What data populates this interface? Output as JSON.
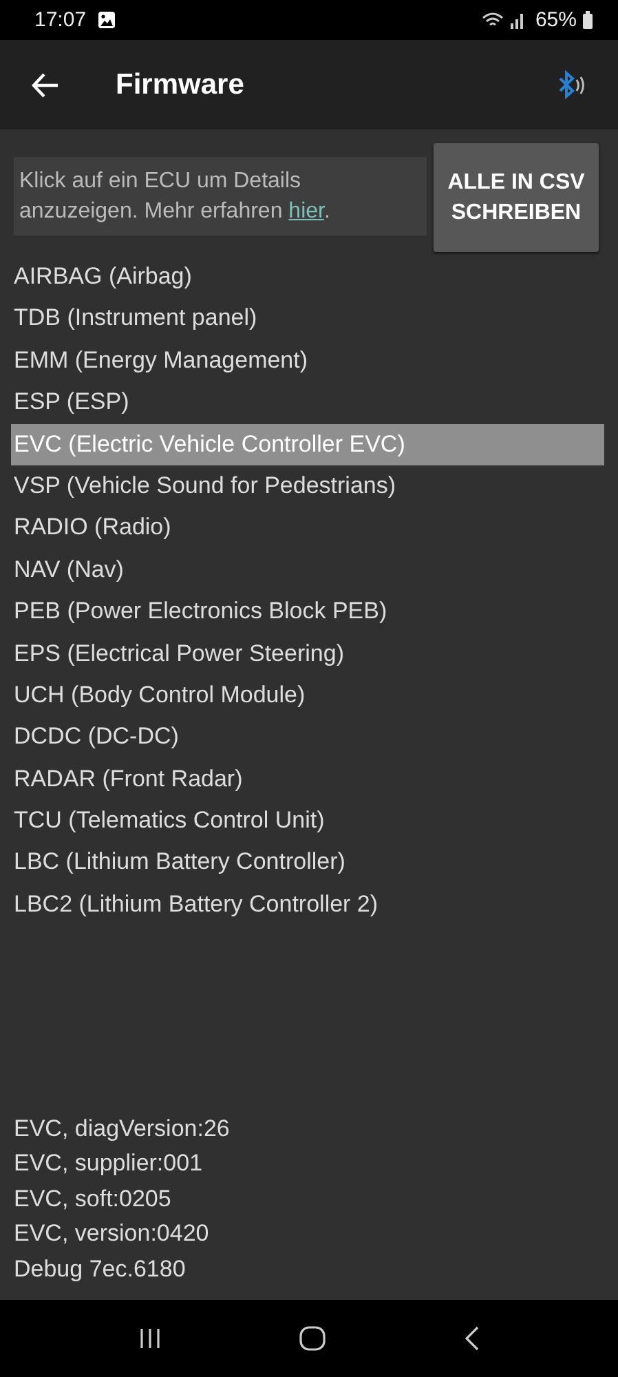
{
  "status_bar": {
    "time": "17:07",
    "battery": "65%"
  },
  "toolbar": {
    "title": "Firmware"
  },
  "info": {
    "text": "Klick auf ein ECU um Details anzuzeigen. Mehr erfahren ",
    "link": "hier",
    "after": "."
  },
  "export_button": "ALLE IN CSV SCHREIBEN",
  "ecus": [
    {
      "label": "AIRBAG (Airbag)",
      "selected": false
    },
    {
      "label": "TDB (Instrument panel)",
      "selected": false
    },
    {
      "label": "EMM (Energy Management)",
      "selected": false
    },
    {
      "label": "ESP (ESP)",
      "selected": false
    },
    {
      "label": "EVC (Electric Vehicle Controller EVC)",
      "selected": true
    },
    {
      "label": "VSP (Vehicle Sound for Pedestrians)",
      "selected": false
    },
    {
      "label": "RADIO (Radio)",
      "selected": false
    },
    {
      "label": "NAV (Nav)",
      "selected": false
    },
    {
      "label": "PEB (Power Electronics Block PEB)",
      "selected": false
    },
    {
      "label": "EPS (Electrical Power Steering)",
      "selected": false
    },
    {
      "label": "UCH (Body Control Module)",
      "selected": false
    },
    {
      "label": "DCDC (DC-DC)",
      "selected": false
    },
    {
      "label": "RADAR (Front Radar)",
      "selected": false
    },
    {
      "label": "TCU (Telematics Control Unit)",
      "selected": false
    },
    {
      "label": "LBC (Lithium Battery Controller)",
      "selected": false
    },
    {
      "label": "LBC2 (Lithium Battery Controller 2)",
      "selected": false
    }
  ],
  "details": [
    "EVC, diagVersion:26",
    "EVC, supplier:001",
    "EVC, soft:0205",
    "EVC, version:0420",
    "Debug 7ec.6180"
  ]
}
